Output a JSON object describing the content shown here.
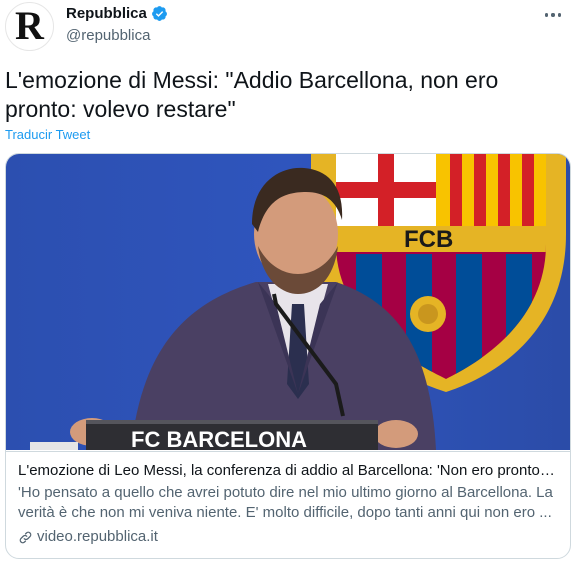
{
  "account": {
    "avatar_letter": "R",
    "display_name": "Repubblica",
    "handle": "@repubblica",
    "verified_icon": "verified-badge-icon"
  },
  "tweet": {
    "text": "L'emozione di Messi: \"Addio Barcellona, non ero pronto: volevo restare\"",
    "translate_label": "Traducir Tweet"
  },
  "card": {
    "image_caption_text": "FC BARCELONA",
    "crest_text": "FCB",
    "title": "L'emozione di Leo Messi, la conferenza di addio al Barcellona: 'Non ero pronto, ...",
    "description": "'Ho pensato a quello che avrei potuto dire nel mio ultimo giorno al Barcellona. La verità è che non mi veniva niente. E' molto difficile, dopo tanti anni qui non ero ...",
    "domain": "video.repubblica.it",
    "domain_icon": "link-icon"
  },
  "colors": {
    "accent": "#1d9bf0",
    "text_primary": "#0f1419",
    "text_secondary": "#536471",
    "border": "#cfd9de"
  }
}
